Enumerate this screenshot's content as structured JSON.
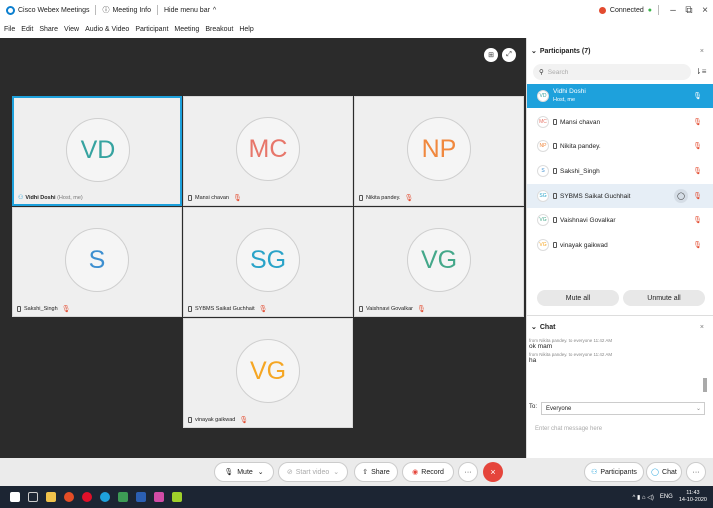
{
  "titlebar": {
    "app": "Cisco Webex Meetings",
    "meeting_info": "Meeting Info",
    "hide_menu": "Hide menu bar",
    "status": "Connected"
  },
  "menu": [
    "File",
    "Edit",
    "Share",
    "View",
    "Audio & Video",
    "Participant",
    "Meeting",
    "Breakout",
    "Help"
  ],
  "tiles": [
    {
      "initials": "VD",
      "name": "Vidhi Doshi",
      "suffix": "(Host, me)",
      "color": "#36a3a0"
    },
    {
      "initials": "MC",
      "name": "Mansi chavan",
      "suffix": "",
      "color": "#e7766a"
    },
    {
      "initials": "NP",
      "name": "Nikita pandey.",
      "suffix": "",
      "color": "#f0883e"
    },
    {
      "initials": "S",
      "name": "Sakshi_Singh",
      "suffix": "",
      "color": "#3d8fd0"
    },
    {
      "initials": "SG",
      "name": "SYBMS Saikat Guchhait",
      "suffix": "",
      "color": "#2aa3c8"
    },
    {
      "initials": "VG",
      "name": "Vaishnavi Govalkar",
      "suffix": "",
      "color": "#44a88a"
    },
    {
      "initials": "VG",
      "name": "vinayak gaikwad",
      "suffix": "",
      "color": "#f5a623"
    }
  ],
  "toolbar": {
    "mute": "Mute",
    "start_video": "Start video",
    "share": "Share",
    "record": "Record",
    "more": "···",
    "participants": "Participants",
    "chat": "Chat"
  },
  "participants": {
    "header": "Participants (7)",
    "search_placeholder": "Search",
    "host_name": "Vidhi Doshi",
    "host_role": "Host, me",
    "list": [
      {
        "initials": "MC",
        "name": "Mansi chavan"
      },
      {
        "initials": "NP",
        "name": "Nikita pandey."
      },
      {
        "initials": "S",
        "name": "Sakshi_Singh"
      },
      {
        "initials": "SG",
        "name": "SYBMS Saikat Guchhait"
      },
      {
        "initials": "VG",
        "name": "Vaishnavi Govalkar"
      },
      {
        "initials": "VG",
        "name": "vinayak gaikwad"
      }
    ],
    "mute_all": "Mute all",
    "unmute_all": "Unmute all"
  },
  "chat": {
    "header": "Chat",
    "messages": [
      {
        "meta": "from Nikita pandey. to everyone   11:42 AM",
        "text": "ok mam"
      },
      {
        "meta": "from Nikita pandey. to everyone   11:42 AM",
        "text": "ha"
      }
    ],
    "to_label": "To:",
    "to_value": "Everyone",
    "placeholder": "Enter chat message here"
  },
  "taskbar": {
    "lang": "ENG",
    "time": "11:43",
    "date": "14-10-2020"
  }
}
